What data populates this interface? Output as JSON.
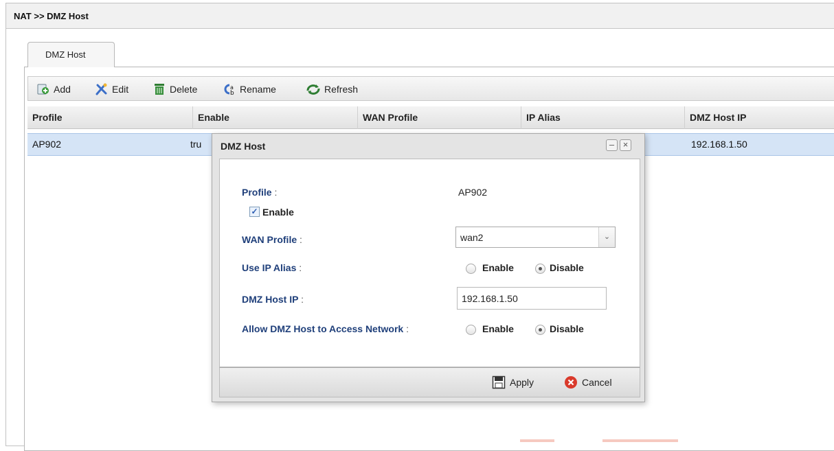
{
  "header": {
    "breadcrumb": "NAT >> DMZ Host"
  },
  "tabs": [
    {
      "label": "DMZ Host"
    }
  ],
  "toolbar": {
    "add": "Add",
    "edit": "Edit",
    "delete": "Delete",
    "rename": "Rename",
    "refresh": "Refresh"
  },
  "grid": {
    "columns": [
      "Profile",
      "Enable",
      "WAN Profile",
      "IP Alias",
      "DMZ Host IP"
    ],
    "rows": [
      {
        "profile": "AP902",
        "enable": "tru",
        "dmz_host_ip": "192.168.1.50"
      }
    ]
  },
  "dialog": {
    "title": "DMZ Host",
    "minimize": "–",
    "close": "×",
    "profile_label": "Profile",
    "profile_value": "AP902",
    "enable_label": "Enable",
    "enable_checked": true,
    "wan_profile_label": "WAN Profile",
    "wan_profile_value": "wan2",
    "use_ip_alias_label": "Use IP Alias",
    "use_ip_alias_options": [
      "Enable",
      "Disable"
    ],
    "use_ip_alias_selected": "Disable",
    "dmz_host_ip_label": "DMZ Host IP",
    "dmz_host_ip_value": "192.168.1.50",
    "allow_access_label": "Allow DMZ Host to Access Network",
    "allow_access_options": [
      "Enable",
      "Disable"
    ],
    "allow_access_selected": "Disable",
    "colon": ":",
    "apply": "Apply",
    "cancel": "Cancel"
  },
  "colors": {
    "label_blue": "#1f3f7a",
    "selected_row": "#d5e4f6",
    "cancel_red": "#d93a2b",
    "add_green": "#3a9b3a"
  }
}
